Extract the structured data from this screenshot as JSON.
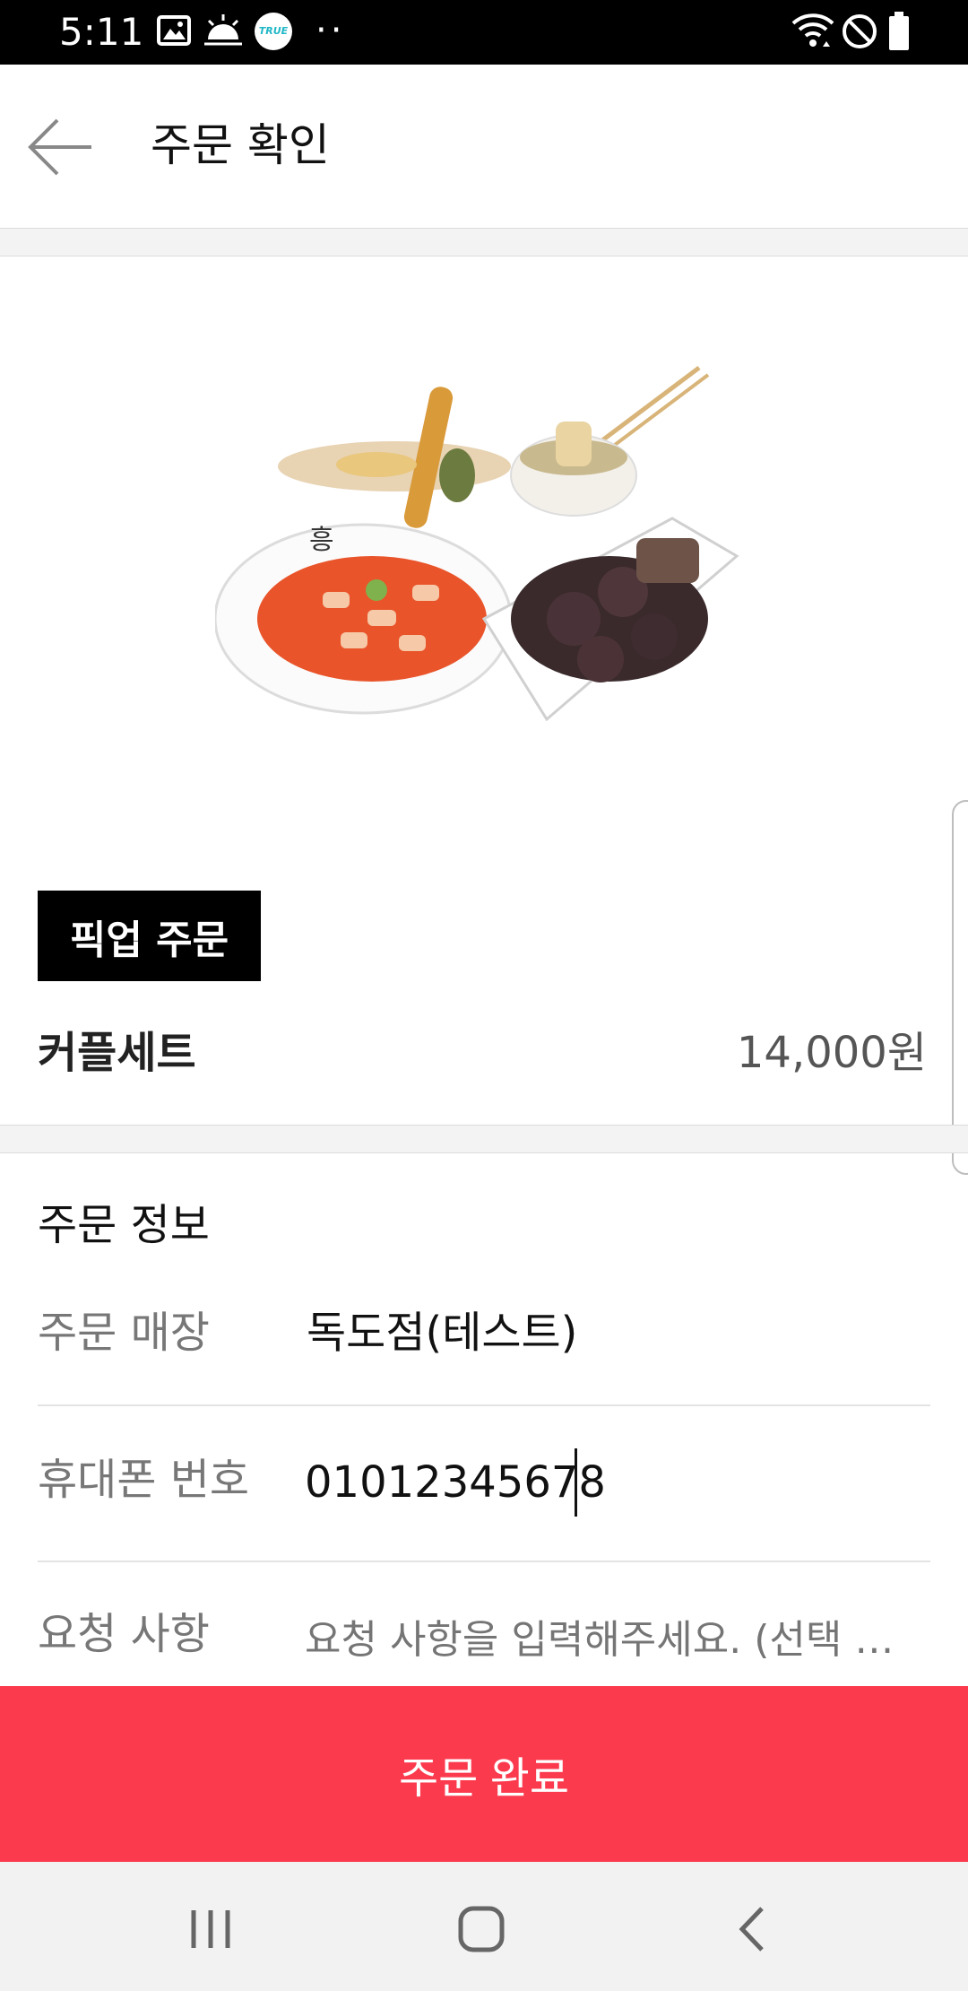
{
  "status_bar": {
    "time": "5:11",
    "badge_text": "TRUE",
    "more_dots": "··",
    "icons": [
      "gallery-icon",
      "weather-icon",
      "true-app-icon",
      "wifi-icon",
      "do-not-disturb-icon",
      "battery-icon"
    ]
  },
  "header": {
    "title": "주문 확인",
    "back_icon": "back-arrow-icon"
  },
  "product": {
    "image": "food-set-image",
    "order_type": "픽업 주문",
    "name": "커플세트",
    "price": "14,000원"
  },
  "order_info": {
    "section_title": "주문 정보",
    "store_label": "주문 매장",
    "store_value": "독도점(테스트)",
    "phone_label": "휴대폰 번호",
    "phone_value": "01012345678",
    "request_label": "요청 사항",
    "request_placeholder": "요청 사항을 입력해주세요. (선택 사..."
  },
  "submit": {
    "label": "주문 완료"
  },
  "nav_bar": {
    "icons": [
      "recent-apps-icon",
      "home-icon",
      "back-icon"
    ]
  },
  "colors": {
    "accent": "#fc3a4e",
    "badge_bg": "#000000",
    "status_bar_bg": "#000000"
  }
}
